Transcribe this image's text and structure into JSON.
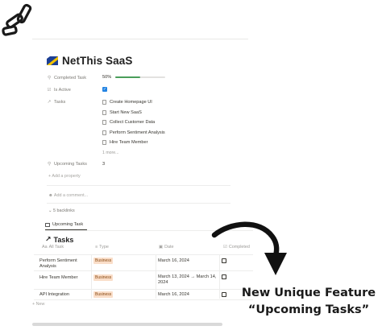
{
  "page": {
    "title": "NetThis SaaS",
    "properties": {
      "completed_task": {
        "label": "Completed Task",
        "value": "50%",
        "progress": 0.5
      },
      "is_active": {
        "label": "Is Active",
        "checked": true
      },
      "tasks": {
        "label": "Tasks",
        "items": [
          "Create Homepage UI",
          "Start New SaaS",
          "Collect Customer Data",
          "Perform Sentiment Analysis",
          "Hire Team Member"
        ],
        "more": "1 more..."
      },
      "upcoming_tasks": {
        "label": "Upcoming Tasks",
        "value": "3"
      },
      "add_property": "+ Add a property"
    },
    "comment_placeholder": "Add a comment...",
    "backlinks": "5 backlinks"
  },
  "view_tab": {
    "label": "Upcoming Task"
  },
  "section": {
    "title": "Tasks"
  },
  "table": {
    "headers": {
      "name": "All Task",
      "type": "Type",
      "date": "Date",
      "completed": "Completed"
    },
    "rows": [
      {
        "name": "Perform Sentiment Analysis",
        "type": "Business",
        "date": "March 16, 2024",
        "completed": false
      },
      {
        "name": "Hire Team Member",
        "type": "Business",
        "date": "March 13, 2024 → March 14, 2024",
        "completed": false
      },
      {
        "name": "API Integration",
        "type": "Business",
        "date": "March 16, 2024",
        "completed": false
      }
    ],
    "new_label": "+ New"
  },
  "callout": {
    "line1": "New Unique Feature",
    "line2": "“Upcoming Tasks”"
  },
  "colors": {
    "accent": "#2383e2",
    "progress": "#4a9e5a",
    "tag_bg": "#fadec9",
    "tag_text": "#8a4b14"
  }
}
